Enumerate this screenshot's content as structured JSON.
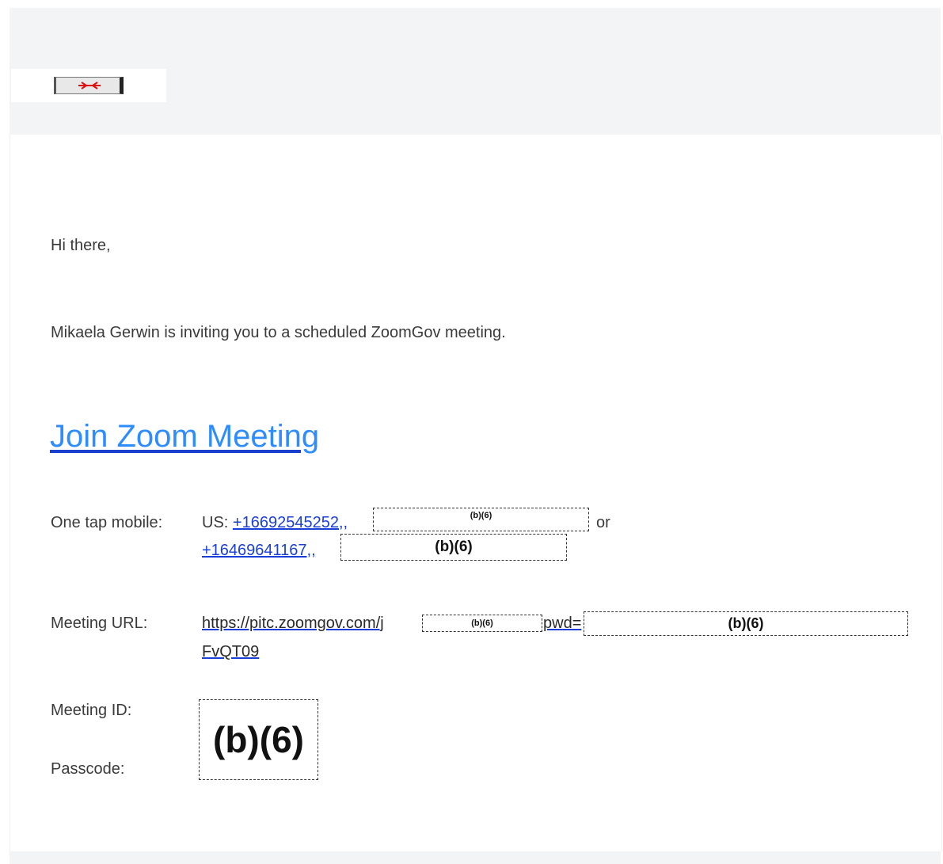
{
  "header": {
    "logo_icon": "zoom-logo-broken-image"
  },
  "body": {
    "greeting": "Hi there,",
    "invite_text": "Mikaela Gerwin is inviting you to a scheduled ZoomGov meeting.",
    "join_link": "Join Zoom Meeting"
  },
  "one_tap": {
    "label": "One tap mobile:",
    "country": "US:",
    "number1": "+16692545252,,",
    "separator": "or",
    "number2": "+16469641167,,"
  },
  "meeting_url": {
    "label": "Meeting URL:",
    "url_start": "https://pitc.zoomgov.com/j",
    "url_mid": "pwd=",
    "url_end": "FvQT09"
  },
  "meeting_id": {
    "label": "Meeting ID:"
  },
  "passcode": {
    "label": "Passcode:"
  },
  "redaction": {
    "label": "(b)(6)"
  }
}
